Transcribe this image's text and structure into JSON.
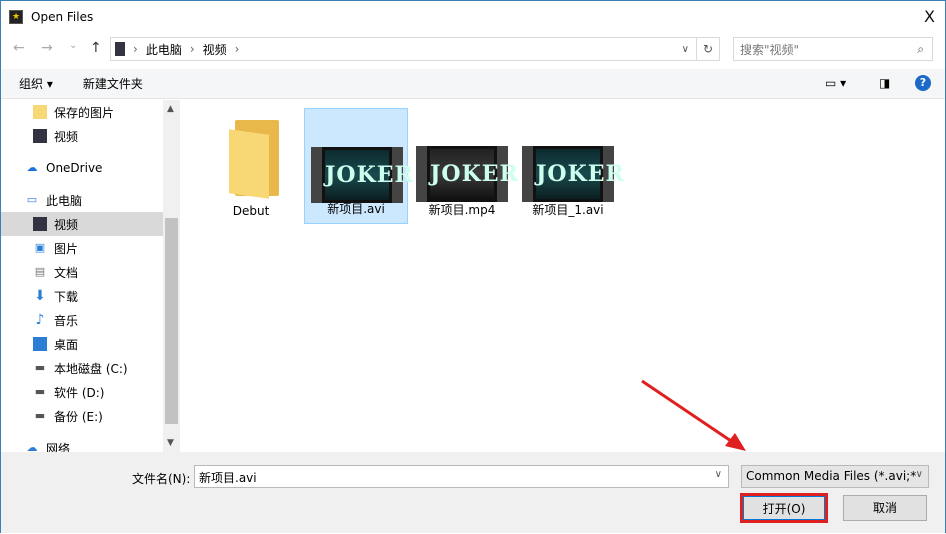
{
  "window": {
    "title": "Open Files",
    "close": "X"
  },
  "nav": {
    "back": "←",
    "forward": "→",
    "recent": "⌄",
    "up": "↑",
    "breadcrumb": [
      "此电脑",
      "视频"
    ],
    "search_placeholder": "搜索\"视频\""
  },
  "toolbar": {
    "organize": "组织 ▾",
    "new_folder": "新建文件夹"
  },
  "sidebar": {
    "items": [
      {
        "label": "保存的图片",
        "icon": "folder-icon"
      },
      {
        "label": "视频",
        "icon": "video-icon"
      },
      {
        "label": "OneDrive",
        "icon": "cloud-icon"
      },
      {
        "label": "此电脑",
        "icon": "computer-icon"
      },
      {
        "label": "视频",
        "icon": "video-icon",
        "selected": true
      },
      {
        "label": "图片",
        "icon": "picture-icon"
      },
      {
        "label": "文档",
        "icon": "document-icon"
      },
      {
        "label": "下载",
        "icon": "download-icon"
      },
      {
        "label": "音乐",
        "icon": "music-icon"
      },
      {
        "label": "桌面",
        "icon": "desktop-icon"
      },
      {
        "label": "本地磁盘 (C:)",
        "icon": "drive-icon"
      },
      {
        "label": "软件 (D:)",
        "icon": "drive-icon"
      },
      {
        "label": "备份 (E:)",
        "icon": "drive-icon"
      },
      {
        "label": "网络",
        "icon": "network-icon"
      }
    ]
  },
  "files": [
    {
      "name": "Debut",
      "type": "folder"
    },
    {
      "name": "新项目.avi",
      "type": "video",
      "selected": true,
      "thumb": "JOKER"
    },
    {
      "name": "新项目.mp4",
      "type": "video",
      "thumb": "JOKER"
    },
    {
      "name": "新项目_1.avi",
      "type": "video",
      "thumb": "JOKER"
    }
  ],
  "bottom": {
    "filename_label": "文件名(N):",
    "filename_value": "新项目.avi",
    "filetype": "Common Media Files (*.avi;*",
    "open": "打开(O)",
    "cancel": "取消"
  },
  "colors": {
    "accent": "#0078d7",
    "highlight": "#e02020",
    "selection": "#cce8ff"
  }
}
